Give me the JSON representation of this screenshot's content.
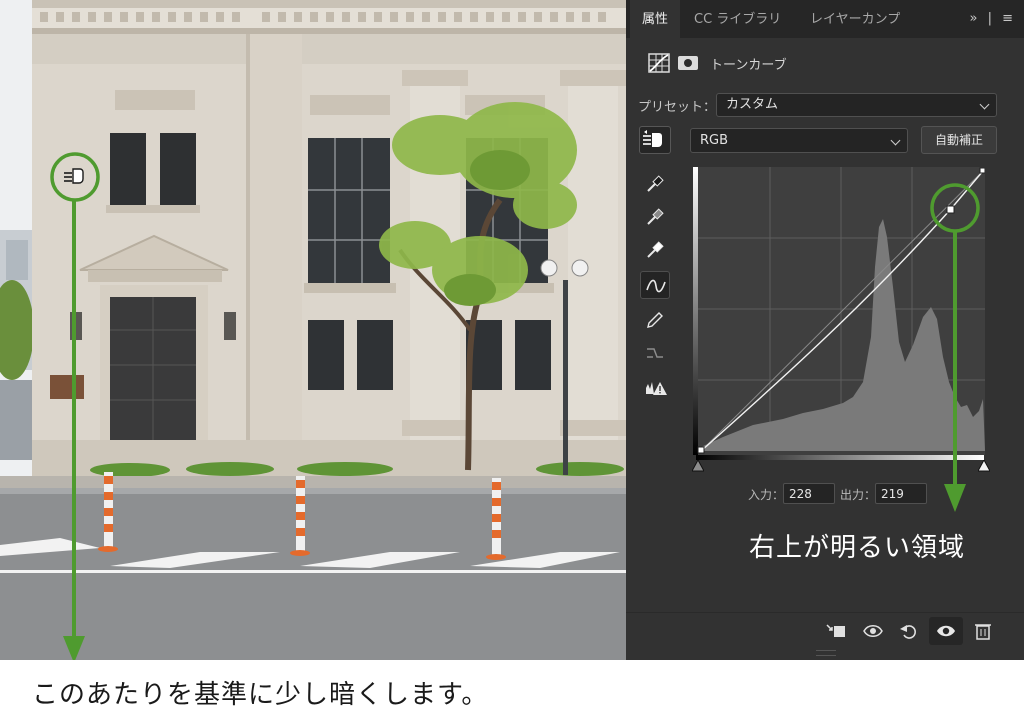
{
  "tabs": [
    {
      "label": "属性",
      "active": true
    },
    {
      "label": "CC ライブラリ",
      "active": false
    },
    {
      "label": "レイヤーカンプ",
      "active": false
    }
  ],
  "tab_overflow_icons": "»  |  ≡",
  "panel_title": "トーンカーブ",
  "preset": {
    "label": "プリセット：",
    "value": "カスタム"
  },
  "channel": {
    "value": "RGB"
  },
  "auto_button": "自動補正",
  "input_output": {
    "input_label": "入力：",
    "input_value": "228",
    "output_label": "出力：",
    "output_value": "219"
  },
  "annotation_right": "右上が明るい領域",
  "caption": "このあたりを基準に少し暗くします。",
  "colors": {
    "panel_bg": "#323232",
    "tab_bg": "#262626",
    "annotation_green": "#4f9b2f"
  }
}
